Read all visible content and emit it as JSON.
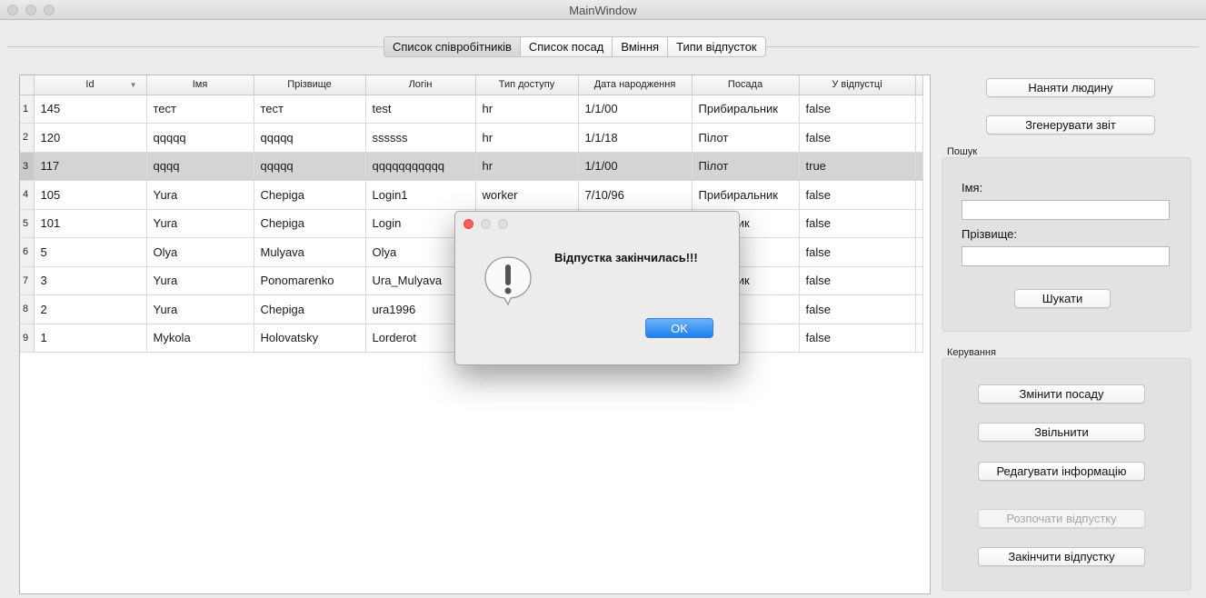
{
  "window": {
    "title": "MainWindow"
  },
  "tabs": [
    {
      "label": "Список співробітників",
      "active": true
    },
    {
      "label": "Список посад",
      "active": false
    },
    {
      "label": "Вміння",
      "active": false
    },
    {
      "label": "Типи відпусток",
      "active": false
    }
  ],
  "table": {
    "columns": [
      "Id",
      "Імя",
      "Прізвище",
      "Логін",
      "Тип доступу",
      "Дата народження",
      "Посада",
      "У відпустці"
    ],
    "rows": [
      {
        "num": "1",
        "cells": [
          "145",
          "тест",
          "тест",
          "test",
          "hr",
          "1/1/00",
          "Прибиральник",
          "false"
        ]
      },
      {
        "num": "2",
        "cells": [
          "120",
          "qqqqq",
          "qqqqq",
          "ssssss",
          "hr",
          "1/1/18",
          "Пілот",
          "false"
        ]
      },
      {
        "num": "3",
        "cells": [
          "117",
          "qqqq",
          "qqqqq",
          "qqqqqqqqqqq",
          "hr",
          "1/1/00",
          "Пілот",
          "true"
        ]
      },
      {
        "num": "4",
        "cells": [
          "105",
          "Yura",
          "Chepiga",
          "Login1",
          "worker",
          "7/10/96",
          "Прибиральник",
          "false"
        ]
      },
      {
        "num": "5",
        "cells": [
          "101",
          "Yura",
          "Chepiga",
          "Login",
          "",
          "",
          "иральник",
          "false"
        ]
      },
      {
        "num": "6",
        "cells": [
          "5",
          "Olya",
          "Mulyava",
          "Olya",
          "",
          "",
          "",
          "false"
        ]
      },
      {
        "num": "7",
        "cells": [
          "3",
          "Yura",
          "Ponomarenko",
          "Ura_Mulyava",
          "",
          "",
          "иральник",
          "false"
        ]
      },
      {
        "num": "8",
        "cells": [
          "2",
          "Yura",
          "Chepiga",
          "ura1996",
          "",
          "",
          "'утер",
          "false"
        ]
      },
      {
        "num": "9",
        "cells": [
          "1",
          "Mykola",
          "Holovatsky",
          "Lorderot",
          "",
          "",
          "",
          "false"
        ]
      }
    ],
    "selected_row": 2
  },
  "right_panel": {
    "hire_button": "Наняти людину",
    "report_button": "Згенерувати звіт",
    "search": {
      "title": "Пошук",
      "first_name_label": "Імя:",
      "last_name_label": "Прізвище:",
      "search_button": "Шукати"
    },
    "control": {
      "title": "Керування",
      "change_position_button": "Змінити посаду",
      "fire_button": "Звільнити",
      "edit_info_button": "Редагувати інформацію",
      "start_vacation_button": "Розпочати відпустку",
      "end_vacation_button": "Закінчити відпустку"
    }
  },
  "dialog": {
    "message": "Відпустка закінчилась!!!",
    "ok_label": "OK",
    "accent_color": "#1f7ff0",
    "close_color": "#fc5f57"
  }
}
